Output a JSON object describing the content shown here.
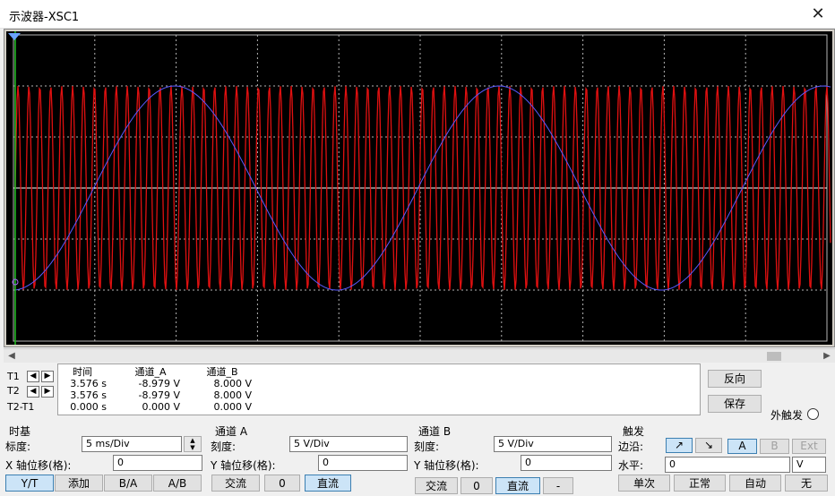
{
  "window": {
    "title": "示波器-XSC1",
    "close_icon": "close-icon"
  },
  "scope": {
    "background": "#000000",
    "grid_color": "#b4b4b4",
    "channel_a_color": "#e01010",
    "channel_b_color": "#5a5aff"
  },
  "cursors": {
    "t1_label": "T1",
    "t2_label": "T2",
    "diff_label": "T2-T1",
    "headers": {
      "time": "时间",
      "ch_a": "通道_A",
      "ch_b": "通道_B"
    },
    "rows": [
      {
        "time": "3.576 s",
        "ch_a": "-8.979 V",
        "ch_b": "8.000 V"
      },
      {
        "time": "3.576 s",
        "ch_a": "-8.979 V",
        "ch_b": "8.000 V"
      },
      {
        "time": "0.000 s",
        "ch_a": "0.000 V",
        "ch_b": "0.000 V"
      }
    ]
  },
  "side_buttons": {
    "reverse": "反向",
    "save": "保存",
    "ext_trigger": "外触发"
  },
  "timebase": {
    "title": "时基",
    "scale_label": "标度:",
    "scale_value": "5 ms/Div",
    "xpos_label": "X 轴位移(格):",
    "xpos_value": "0",
    "buttons": [
      "Y/T",
      "添加",
      "B/A",
      "A/B"
    ]
  },
  "channel_a": {
    "title": "通道 A",
    "scale_label": "刻度:",
    "scale_value": "5  V/Div",
    "ypos_label": "Y 轴位移(格):",
    "ypos_value": "0",
    "buttons": [
      "交流",
      "0",
      "直流"
    ]
  },
  "channel_b": {
    "title": "通道 B",
    "scale_label": "刻度:",
    "scale_value": "5  V/Div",
    "ypos_label": "Y 轴位移(格):",
    "ypos_value": "0",
    "buttons": [
      "交流",
      "0",
      "直流",
      "-"
    ]
  },
  "trigger": {
    "title": "触发",
    "edge_label": "边沿:",
    "level_label": "水平:",
    "level_value": "0",
    "level_unit": "V",
    "sources": [
      "A",
      "B",
      "Ext"
    ],
    "modes": [
      "单次",
      "正常",
      "自动",
      "无"
    ]
  }
}
